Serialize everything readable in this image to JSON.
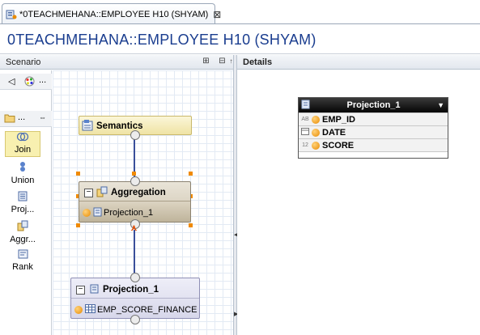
{
  "editor": {
    "tab_label": "*0TEACHMEHANA::EMPLOYEE H10 (SHYAM)",
    "tab_close": "⊠",
    "page_title": "0TEACHMEHANA::EMPLOYEE H10 (SHYAM)"
  },
  "scenario": {
    "title": "Scenario",
    "expand_icon": "⊞",
    "collapse_icon": "⊟",
    "palette_more": "...",
    "folder_more": "...",
    "tools": [
      {
        "label": "Join"
      },
      {
        "label": "Union"
      },
      {
        "label": "Proj..."
      },
      {
        "label": "Aggr..."
      },
      {
        "label": "Rank"
      }
    ],
    "nodes": {
      "semantics": {
        "title": "Semantics"
      },
      "aggregation": {
        "title": "Aggregation",
        "input": "Projection_1"
      },
      "projection": {
        "title": "Projection_1",
        "input": "EMP_SCORE_FINANCE"
      }
    }
  },
  "details": {
    "title": "Details",
    "table": {
      "title": "Projection_1",
      "rows": [
        {
          "type": "AB",
          "name": "EMP_ID"
        },
        {
          "type": "",
          "name": "DATE"
        },
        {
          "type": "12",
          "name": "SCORE"
        }
      ]
    }
  }
}
